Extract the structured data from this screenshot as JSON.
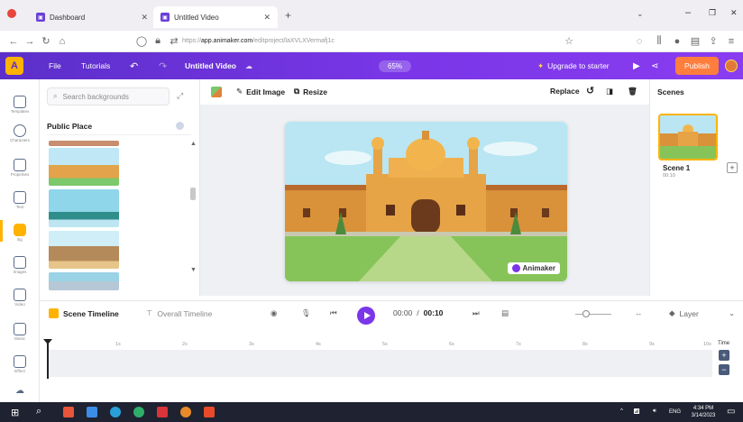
{
  "browser": {
    "tabs": [
      {
        "label": "Dashboard",
        "active": false
      },
      {
        "label": "Untitled Video",
        "active": true
      }
    ],
    "url_prefix": "https://",
    "url_domain": "app.animaker.com",
    "url_path": "/editproject/laXVLXVermafj1c"
  },
  "appbar": {
    "file": "File",
    "tutorials": "Tutorials",
    "project_title": "Untitled Video",
    "zoom": "65%",
    "upgrade": "Upgrade to starter",
    "publish": "Publish"
  },
  "rail": {
    "items": [
      {
        "label": "Templates"
      },
      {
        "label": "Characters"
      },
      {
        "label": "Properties"
      },
      {
        "label": "Text"
      },
      {
        "label": "Bg",
        "active": true
      },
      {
        "label": "Images"
      },
      {
        "label": "Video"
      },
      {
        "label": "Music"
      },
      {
        "label": "Effect"
      }
    ]
  },
  "library": {
    "search_placeholder": "Search backgrounds",
    "category": "Public Place"
  },
  "toolbar": {
    "edit_image": "Edit Image",
    "resize": "Resize",
    "replace": "Replace",
    "scenes_title": "Scenes"
  },
  "canvas": {
    "watermark": "Animaker"
  },
  "scenes": {
    "items": [
      {
        "label": "Scene 1",
        "duration": "00:10"
      }
    ]
  },
  "timeline": {
    "scene_timeline": "Scene Timeline",
    "overall_timeline": "Overall Timeline",
    "current_time": "00:00",
    "separator": "/",
    "total_time": "00:10",
    "layer": "Layer",
    "time_label": "Time",
    "ruler": [
      "1s",
      "2s",
      "3s",
      "4s",
      "5s",
      "6s",
      "7s",
      "8s",
      "9s",
      "10s"
    ]
  },
  "taskbar": {
    "language": "ENG",
    "time": "4:34 PM",
    "date": "3/14/2023"
  },
  "colors": {
    "brand": "#7a36e8",
    "accent": "#ffb300",
    "publish": "#ff7e3e"
  }
}
